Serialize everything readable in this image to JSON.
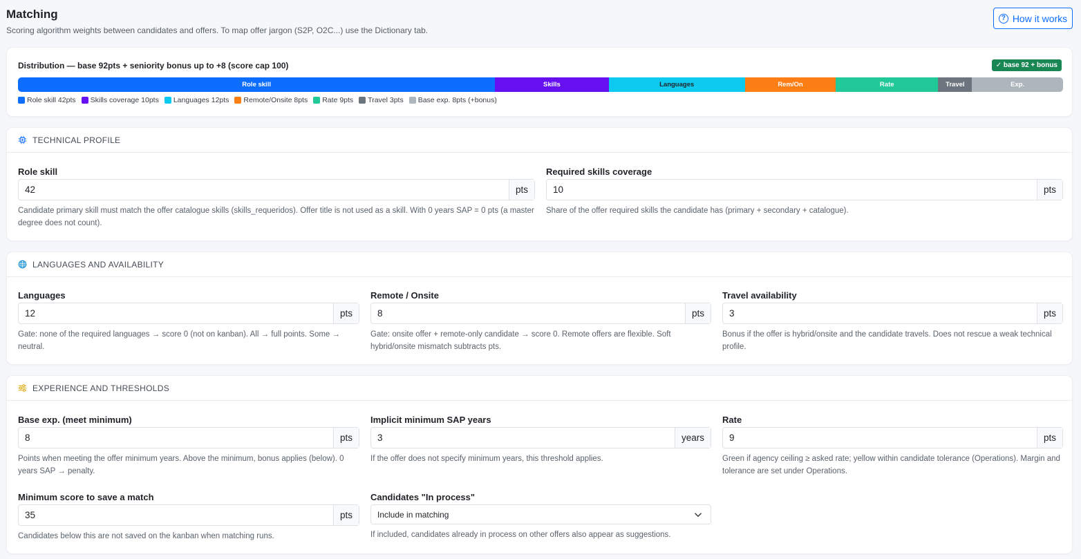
{
  "header": {
    "title": "Matching",
    "subtitle": "Scoring algorithm weights between candidates and offers. To map offer jargon (S2P, O2C...) use the Dictionary tab.",
    "how_button": "How it works"
  },
  "distribution": {
    "title": "Distribution — base 92pts + seniority bonus up to +8 (score cap 100)",
    "badge": "✓ base 92 + bonus",
    "segments": [
      {
        "label": "Role skill",
        "points": 42,
        "color": "#0d6efd",
        "text_color": "#ffffff"
      },
      {
        "label": "Skills",
        "points": 10,
        "color": "#6610f2",
        "text_color": "#ffffff"
      },
      {
        "label": "Languages",
        "points": 12,
        "color": "#0dcaf0",
        "text_color": "#1f2328"
      },
      {
        "label": "Rem/On",
        "points": 8,
        "color": "#fd7e14",
        "text_color": "#ffffff"
      },
      {
        "label": "Rate",
        "points": 9,
        "color": "#20c997",
        "text_color": "#ffffff"
      },
      {
        "label": "Travel",
        "points": 3,
        "color": "#6c757d",
        "text_color": "#ffffff"
      },
      {
        "label": "Exp.",
        "points": 8,
        "color": "#adb5bd",
        "text_color": "#ffffff"
      }
    ],
    "legend": [
      {
        "label": "Role skill 42pts",
        "color": "#0d6efd"
      },
      {
        "label": "Skills coverage 10pts",
        "color": "#6610f2"
      },
      {
        "label": "Languages 12pts",
        "color": "#0dcaf0"
      },
      {
        "label": "Remote/Onsite 8pts",
        "color": "#fd7e14"
      },
      {
        "label": "Rate 9pts",
        "color": "#20c997"
      },
      {
        "label": "Travel 3pts",
        "color": "#6c757d"
      },
      {
        "label": "Base exp. 8pts (+bonus)",
        "color": "#adb5bd"
      }
    ]
  },
  "technical": {
    "heading": "TECHNICAL PROFILE",
    "icon": "cpu-icon",
    "role_skill": {
      "label": "Role skill",
      "value": "42",
      "unit": "pts",
      "help": "Candidate primary skill must match the offer catalogue skills (skills_requeridos). Offer title is not used as a skill. With 0 years SAP = 0 pts (a master degree does not count)."
    },
    "skills_coverage": {
      "label": "Required skills coverage",
      "value": "10",
      "unit": "pts",
      "help": "Share of the offer required skills the candidate has (primary + secondary + catalogue)."
    }
  },
  "languages": {
    "heading": "LANGUAGES AND AVAILABILITY",
    "icon": "globe-icon",
    "lang": {
      "label": "Languages",
      "value": "12",
      "unit": "pts",
      "help": "Gate: none of the required languages → score 0 (not on kanban). All → full points. Some → neutral."
    },
    "remote": {
      "label": "Remote / Onsite",
      "value": "8",
      "unit": "pts",
      "help": "Gate: onsite offer + remote-only candidate → score 0. Remote offers are flexible. Soft hybrid/onsite mismatch subtracts pts."
    },
    "travel": {
      "label": "Travel availability",
      "value": "3",
      "unit": "pts",
      "help": "Bonus if the offer is hybrid/onsite and the candidate travels. Does not rescue a weak technical profile."
    }
  },
  "experience": {
    "heading": "EXPERIENCE AND THRESHOLDS",
    "icon": "sliders-icon",
    "base_exp": {
      "label": "Base exp. (meet minimum)",
      "value": "8",
      "unit": "pts",
      "help": "Points when meeting the offer minimum years. Above the minimum, bonus applies (below). 0 years SAP → penalty."
    },
    "min_years": {
      "label": "Implicit minimum SAP years",
      "value": "3",
      "unit": "years",
      "help": "If the offer does not specify minimum years, this threshold applies."
    },
    "rate": {
      "label": "Rate",
      "value": "9",
      "unit": "pts",
      "help": "Green if agency ceiling ≥ asked rate; yellow within candidate tolerance (Operations). Margin and tolerance are set under Operations."
    },
    "min_score": {
      "label": "Minimum score to save a match",
      "value": "35",
      "unit": "pts",
      "help": "Candidates below this are not saved on the kanban when matching runs."
    },
    "in_process": {
      "label": "Candidates \"In process\"",
      "selected": "Include in matching",
      "help": "If included, candidates already in process on other offers also appear as suggestions."
    }
  }
}
